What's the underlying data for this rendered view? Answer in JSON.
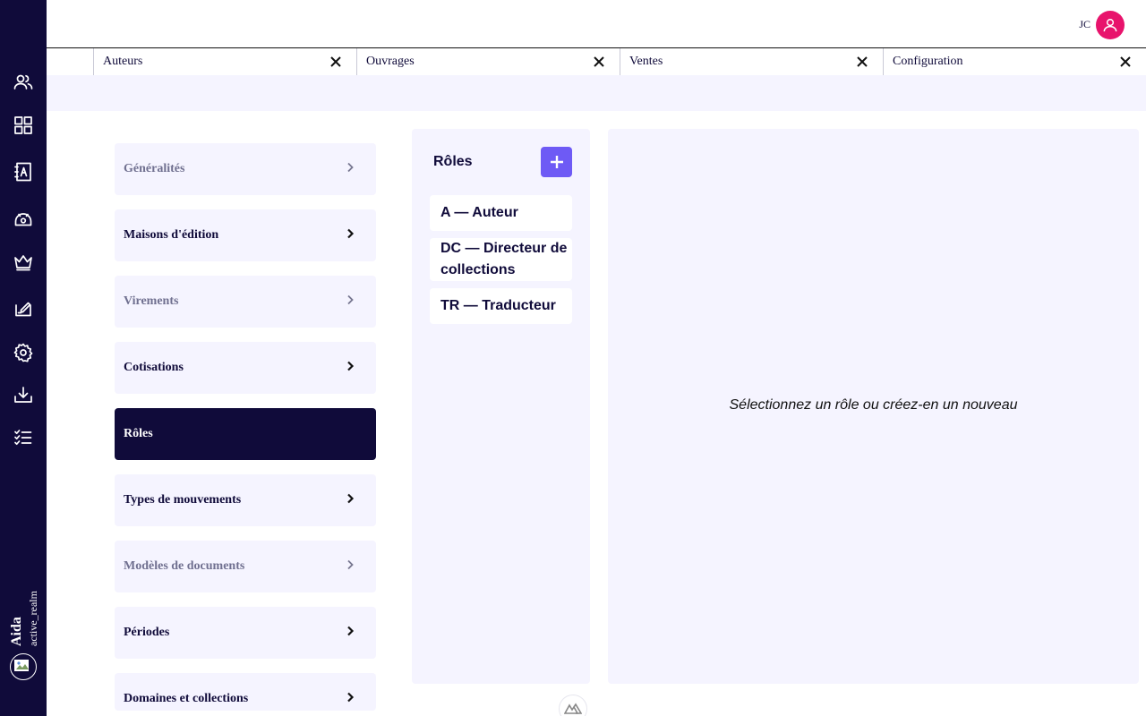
{
  "app": {
    "brand_name": "Aida",
    "realm": "active_realm"
  },
  "rail": {
    "icons": [
      "users-icon",
      "dashboard-icon",
      "address-book-icon",
      "cash-icon",
      "crown-icon",
      "signature-icon",
      "gear-icon",
      "download-icon",
      "checklist-icon"
    ]
  },
  "user": {
    "initials": "JC"
  },
  "tabs": [
    {
      "label": "Auteurs"
    },
    {
      "label": "Ouvrages"
    },
    {
      "label": "Ventes"
    },
    {
      "label": "Configuration"
    }
  ],
  "config_menu": [
    {
      "label": "Généralités",
      "state": "dim"
    },
    {
      "label": "Maisons d'édition",
      "state": "normal"
    },
    {
      "label": "Virements",
      "state": "dim"
    },
    {
      "label": "Cotisations",
      "state": "normal"
    },
    {
      "label": "Rôles",
      "state": "active"
    },
    {
      "label": "Types de mouvements",
      "state": "normal"
    },
    {
      "label": "Modèles de documents",
      "state": "dim"
    },
    {
      "label": "Périodes",
      "state": "normal"
    },
    {
      "label": "Domaines et collections",
      "state": "normal"
    }
  ],
  "roles": {
    "title": "Rôles",
    "items": [
      {
        "label": "A — Auteur"
      },
      {
        "label": "DC — Directeur de collections"
      },
      {
        "label": "TR — Traducteur"
      }
    ]
  },
  "detail": {
    "empty_message": "Sélectionnez un rôle ou créez-en un nouveau"
  },
  "colors": {
    "navy": "#100b3a",
    "accent": "#6e5af5",
    "avatar": "#e8136c",
    "panel": "#f5f4ff"
  }
}
